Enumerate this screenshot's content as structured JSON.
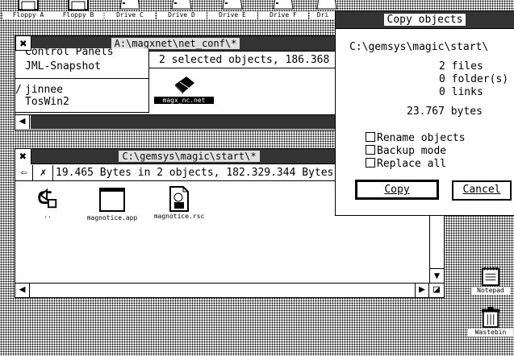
{
  "desktop": {
    "icons": [
      {
        "label": "Floppy A"
      },
      {
        "label": "Floppy B"
      },
      {
        "label": "Drive C"
      },
      {
        "label": "Drive D"
      },
      {
        "label": "Drive E"
      },
      {
        "label": "Drive F"
      },
      {
        "label": "Dri"
      }
    ],
    "notepad_label": "Notepad",
    "trash_label": "Wastebin"
  },
  "window1": {
    "title": "A:\\magxnet\\net_conf\\*",
    "info": "2 selected objects, 186.368",
    "file": {
      "label": "magx_nc.net"
    }
  },
  "popup_menu": {
    "items": [
      "Control Panels",
      "JML-Snapshot",
      "jinnee",
      "TosWin2"
    ]
  },
  "window2": {
    "title": "C:\\gemsys\\magic\\start\\*",
    "info": "19.465 Bytes in 2 objects, 182.329.344 Bytes",
    "files": [
      {
        "label": ".."
      },
      {
        "label": "magnotice.app"
      },
      {
        "label": "magnotice.rsc"
      }
    ]
  },
  "dialog": {
    "title": "Copy objects",
    "path": "C:\\gemsys\\magic\\start\\",
    "stats": [
      "2 files",
      "0 folder(s)",
      "0 links"
    ],
    "bytes": "23.767 bytes",
    "options": [
      {
        "label": "Rename objects",
        "checked": false
      },
      {
        "label": "Backup mode",
        "checked": false
      },
      {
        "label": "Replace all",
        "checked": false
      }
    ],
    "copy_label": "Copy",
    "cancel_label": "Cancel"
  }
}
